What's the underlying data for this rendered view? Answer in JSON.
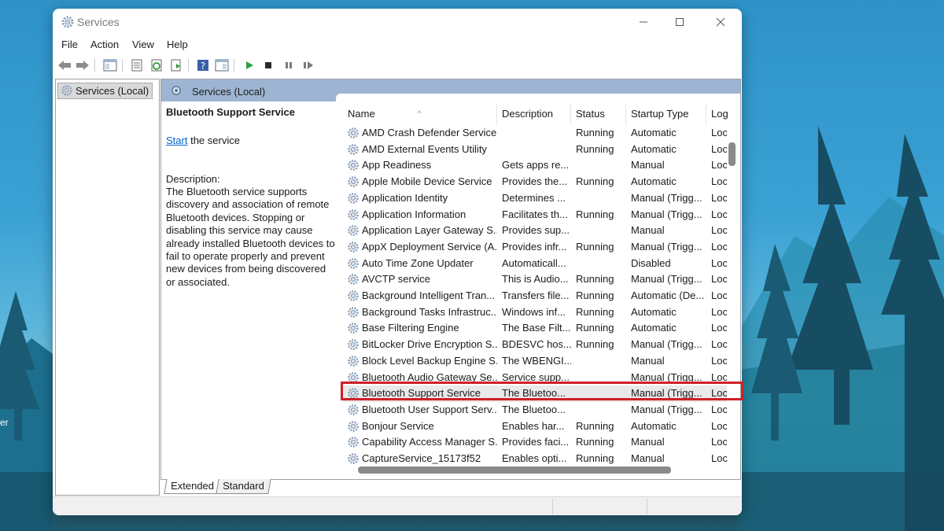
{
  "desktop": {
    "edge_label": "er"
  },
  "window": {
    "title": "Services"
  },
  "menu": [
    "File",
    "Action",
    "View",
    "Help"
  ],
  "tree": {
    "root": "Services (Local)"
  },
  "content": {
    "header": "Services (Local)",
    "selected_service": {
      "title": "Bluetooth Support Service",
      "action_link": "Start",
      "action_suffix": " the service",
      "description_label": "Description:",
      "description": "The Bluetooth service supports discovery and association of remote Bluetooth devices.  Stopping or disabling this service may cause already installed Bluetooth devices to fail to operate properly and prevent new devices from being discovered or associated."
    }
  },
  "columns": [
    "Name",
    "Description",
    "Status",
    "Startup Type",
    "Log"
  ],
  "services": [
    {
      "name": "AMD Crash Defender Service",
      "description": "",
      "status": "Running",
      "startup": "Automatic",
      "log": "Loc"
    },
    {
      "name": "AMD External Events Utility",
      "description": "",
      "status": "Running",
      "startup": "Automatic",
      "log": "Loc"
    },
    {
      "name": "App Readiness",
      "description": "Gets apps re...",
      "status": "",
      "startup": "Manual",
      "log": "Loc"
    },
    {
      "name": "Apple Mobile Device Service",
      "description": "Provides the...",
      "status": "Running",
      "startup": "Automatic",
      "log": "Loc"
    },
    {
      "name": "Application Identity",
      "description": "Determines ...",
      "status": "",
      "startup": "Manual (Trigg...",
      "log": "Loc"
    },
    {
      "name": "Application Information",
      "description": "Facilitates th...",
      "status": "Running",
      "startup": "Manual (Trigg...",
      "log": "Loc"
    },
    {
      "name": "Application Layer Gateway S...",
      "description": "Provides sup...",
      "status": "",
      "startup": "Manual",
      "log": "Loc"
    },
    {
      "name": "AppX Deployment Service (A...",
      "description": "Provides infr...",
      "status": "Running",
      "startup": "Manual (Trigg...",
      "log": "Loc"
    },
    {
      "name": "Auto Time Zone Updater",
      "description": "Automaticall...",
      "status": "",
      "startup": "Disabled",
      "log": "Loc"
    },
    {
      "name": "AVCTP service",
      "description": "This is Audio...",
      "status": "Running",
      "startup": "Manual (Trigg...",
      "log": "Loc"
    },
    {
      "name": "Background Intelligent Tran...",
      "description": "Transfers file...",
      "status": "Running",
      "startup": "Automatic (De...",
      "log": "Loc"
    },
    {
      "name": "Background Tasks Infrastruc...",
      "description": "Windows inf...",
      "status": "Running",
      "startup": "Automatic",
      "log": "Loc"
    },
    {
      "name": "Base Filtering Engine",
      "description": "The Base Filt...",
      "status": "Running",
      "startup": "Automatic",
      "log": "Loc"
    },
    {
      "name": "BitLocker Drive Encryption S...",
      "description": "BDESVC hos...",
      "status": "Running",
      "startup": "Manual (Trigg...",
      "log": "Loc"
    },
    {
      "name": "Block Level Backup Engine S...",
      "description": "The WBENGI...",
      "status": "",
      "startup": "Manual",
      "log": "Loc"
    },
    {
      "name": "Bluetooth Audio Gateway Se...",
      "description": "Service supp...",
      "status": "",
      "startup": "Manual (Trigg...",
      "log": "Loc"
    },
    {
      "name": "Bluetooth Support Service",
      "description": "The Bluetoo...",
      "status": "",
      "startup": "Manual (Trigg...",
      "log": "Loc"
    },
    {
      "name": "Bluetooth User Support Serv...",
      "description": "The Bluetoo...",
      "status": "",
      "startup": "Manual (Trigg...",
      "log": "Loc"
    },
    {
      "name": "Bonjour Service",
      "description": "Enables har...",
      "status": "Running",
      "startup": "Automatic",
      "log": "Loc"
    },
    {
      "name": "Capability Access Manager S...",
      "description": "Provides faci...",
      "status": "Running",
      "startup": "Manual",
      "log": "Loc"
    },
    {
      "name": "CaptureService_15173f52",
      "description": "Enables opti...",
      "status": "Running",
      "startup": "Manual",
      "log": "Loc"
    }
  ],
  "selected_row": 16,
  "tabs": [
    "Extended",
    "Standard"
  ],
  "colors": {
    "highlight": "#d01f2a",
    "header_band": "#9db5d2",
    "link": "#0066cc"
  }
}
